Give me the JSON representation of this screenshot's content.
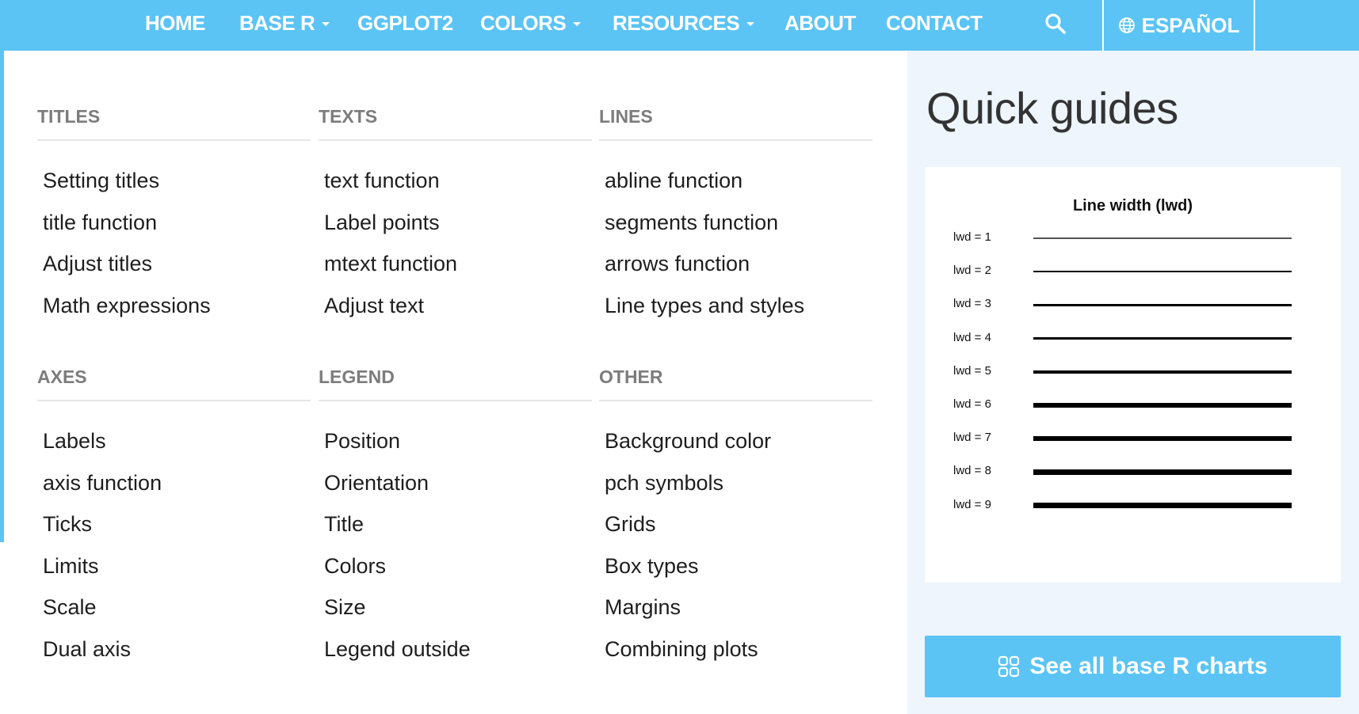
{
  "nav": {
    "items": [
      {
        "label": "HOME",
        "dropdown": false
      },
      {
        "label": "BASE R",
        "dropdown": true
      },
      {
        "label": "GGPLOT2",
        "dropdown": false
      },
      {
        "label": "COLORS",
        "dropdown": true
      },
      {
        "label": "RESOURCES",
        "dropdown": true
      },
      {
        "label": "ABOUT",
        "dropdown": false
      },
      {
        "label": "CONTACT",
        "dropdown": false
      }
    ],
    "language": "ESPAÑOL",
    "icons": {
      "search": "search-icon",
      "language": "globe-icon"
    }
  },
  "menu": {
    "sections": [
      {
        "heading": "TITLES",
        "links": [
          "Setting titles",
          "title function",
          "Adjust titles",
          "Math expressions"
        ]
      },
      {
        "heading": "TEXTS",
        "links": [
          "text function",
          "Label points",
          "mtext function",
          "Adjust text"
        ]
      },
      {
        "heading": "LINES",
        "links": [
          "abline function",
          "segments function",
          "arrows function",
          "Line types and styles"
        ]
      },
      {
        "heading": "AXES",
        "links": [
          "Labels",
          "axis function",
          "Ticks",
          "Limits",
          "Scale",
          "Dual axis"
        ]
      },
      {
        "heading": "LEGEND",
        "links": [
          "Position",
          "Orientation",
          "Title",
          "Colors",
          "Size",
          "Legend outside"
        ]
      },
      {
        "heading": "OTHER",
        "links": [
          "Background color",
          "pch symbols",
          "Grids",
          "Box types",
          "Margins",
          "Combining plots"
        ]
      }
    ]
  },
  "quick_guides": {
    "title": "Quick guides",
    "card_title": "Line width (lwd)",
    "rows": [
      "lwd = 1",
      "lwd = 2",
      "lwd = 3",
      "lwd = 4",
      "lwd = 5",
      "lwd = 6",
      "lwd = 7",
      "lwd = 8",
      "lwd = 9"
    ],
    "line_widths": [
      1,
      2,
      3,
      4,
      5,
      6,
      7,
      8,
      9
    ],
    "carousel": {
      "count": 5,
      "active": 5
    },
    "button_label": "See all base R charts",
    "button_icon": "grid-icon"
  },
  "colors": {
    "accent": "#5bc4f5",
    "panel_bg": "#eef5fd",
    "heading": "#7c7c7c"
  }
}
